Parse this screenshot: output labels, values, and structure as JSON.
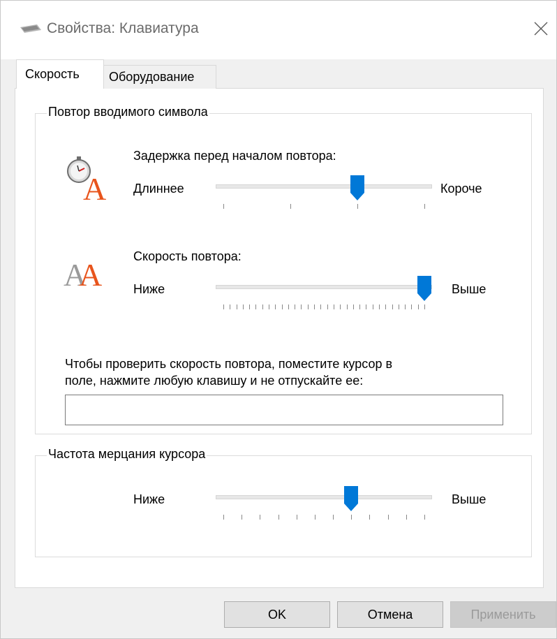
{
  "window": {
    "title": "Свойства: Клавиатура"
  },
  "tabs": [
    {
      "label": "Скорость",
      "active": true
    },
    {
      "label": "Оборудование",
      "active": false
    }
  ],
  "repeat_group": {
    "label": "Повтор вводимого символа",
    "delay": {
      "label": "Задержка перед началом повтора:",
      "min_label": "Длиннее",
      "max_label": "Короче",
      "value": 2,
      "min": 0,
      "max": 3
    },
    "rate": {
      "label": "Скорость повтора:",
      "min_label": "Ниже",
      "max_label": "Выше",
      "value": 31,
      "min": 0,
      "max": 31
    },
    "test": {
      "instruction_line1": "Чтобы проверить скорость повтора, поместите курсор в",
      "instruction_line2": "поле, нажмите любую клавишу и не отпускайте ее:",
      "value": ""
    }
  },
  "blink_group": {
    "label": "Частота мерцания курсора",
    "min_label": "Ниже",
    "max_label": "Выше",
    "value": 7,
    "min": 0,
    "max": 11
  },
  "buttons": {
    "ok": "OK",
    "cancel": "Отмена",
    "apply": "Применить",
    "apply_enabled": false
  },
  "colors": {
    "accent": "#0078d7",
    "icon_letter": "#e8541c"
  }
}
